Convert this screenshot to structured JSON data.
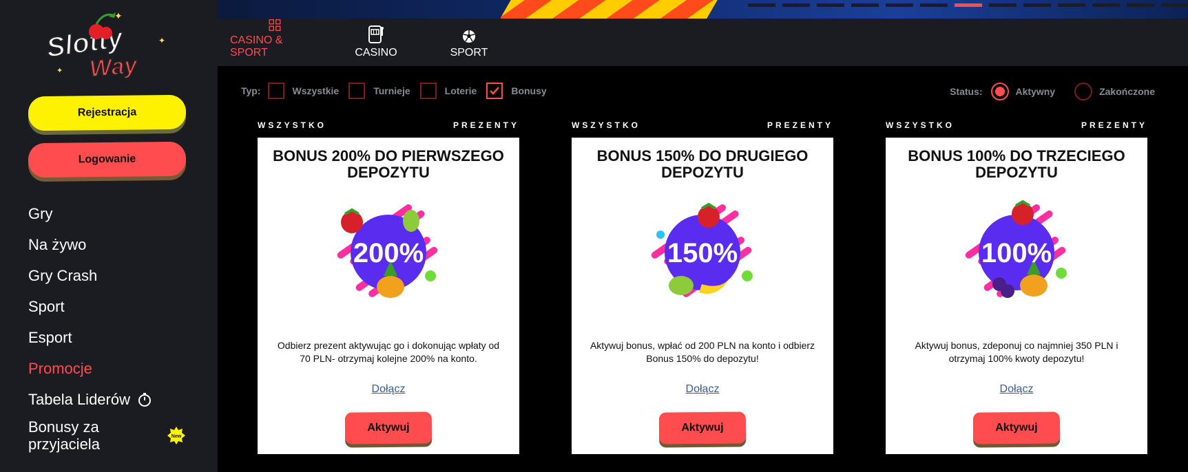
{
  "sidebar": {
    "register_label": "Rejestracja",
    "login_label": "Logowanie",
    "nav": [
      {
        "label": "Gry"
      },
      {
        "label": "Na żywo"
      },
      {
        "label": "Gry Crash"
      },
      {
        "label": "Sport"
      },
      {
        "label": "Esport"
      },
      {
        "label": "Promocje"
      },
      {
        "label": "Tabela Liderów"
      },
      {
        "label": "Bonusy za przyjaciela"
      }
    ],
    "new_badge": "New"
  },
  "tabs": [
    {
      "label": "CASINO & SPORT"
    },
    {
      "label": "CASINO"
    },
    {
      "label": "SPORT"
    }
  ],
  "filters": {
    "type_label": "Typ:",
    "options": [
      {
        "label": "Wszystkie"
      },
      {
        "label": "Turnieje"
      },
      {
        "label": "Loterie"
      },
      {
        "label": "Bonusy"
      }
    ],
    "status_label": "Status:",
    "status_options": [
      {
        "label": "Aktywny"
      },
      {
        "label": "Zakończone"
      }
    ]
  },
  "cards": [
    {
      "left_tag": "WSZYSTKO",
      "right_tag": "PREZENTY",
      "title": "BONUS 200% DO PIERWSZEGO DEPOZYTU",
      "percent": "200%",
      "description": "Odbierz prezent aktywując go i dokonując wpłaty od 70 PLN- otrzymaj kolejne 200% na konto.",
      "link": "Dołącz",
      "button": "Aktywuj"
    },
    {
      "left_tag": "WSZYSTKO",
      "right_tag": "PREZENTY",
      "title": "BONUS 150% DO DRUGIEGO DEPOZYTU",
      "percent": "150%",
      "description": "Aktywuj bonus, wpłać od 200 PLN na konto i odbierz Bonus 150% do depozytu!",
      "link": "Dołącz",
      "button": "Aktywuj"
    },
    {
      "left_tag": "WSZYSTKO",
      "right_tag": "PREZENTY",
      "title": "BONUS 100% DO TRZECIEGO DEPOZYTU",
      "percent": "100%",
      "description": "Aktywuj bonus, zdeponuj co najmniej 350 PLN i otrzymaj 100% kwoty depozytu!",
      "link": "Dołącz",
      "button": "Aktywuj"
    }
  ],
  "colors": {
    "accent": "#ff4d4f",
    "register": "#fff200",
    "sidebar_bg": "#1a1c22"
  }
}
